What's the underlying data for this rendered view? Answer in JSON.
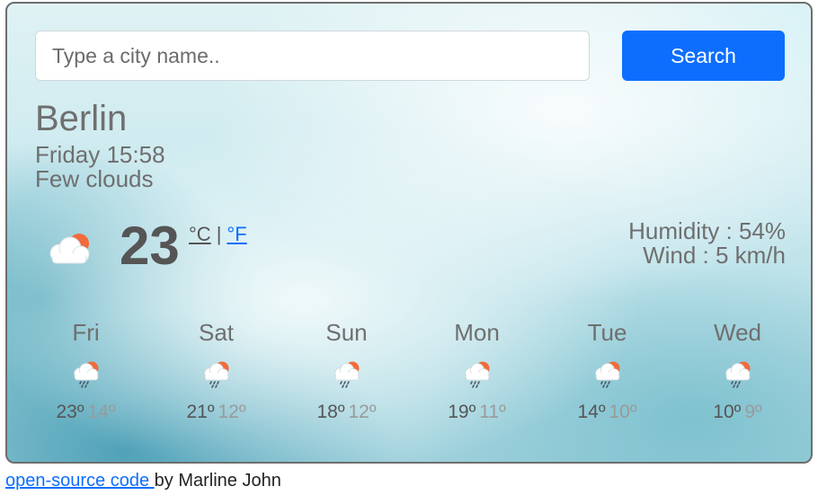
{
  "search": {
    "placeholder": "Type a city name..",
    "value": "",
    "button_label": "Search"
  },
  "current": {
    "city": "Berlin",
    "datetime": "Friday 15:58",
    "description": "Few clouds",
    "temperature": "23",
    "unit_celsius": "°C",
    "unit_separator": "|",
    "unit_fahrenheit": "°F",
    "humidity": "Humidity : 54%",
    "wind": "Wind : 5 km/h",
    "icon": "sun-behind-cloud-icon"
  },
  "forecast": [
    {
      "day": "Fri",
      "max": "23º",
      "min": "14º",
      "icon": "sun-cloud-rain-icon"
    },
    {
      "day": "Sat",
      "max": "21º",
      "min": "12º",
      "icon": "sun-cloud-rain-icon"
    },
    {
      "day": "Sun",
      "max": "18º",
      "min": "12º",
      "icon": "sun-cloud-rain-icon"
    },
    {
      "day": "Mon",
      "max": "19º",
      "min": "11º",
      "icon": "sun-cloud-rain-icon"
    },
    {
      "day": "Tue",
      "max": "14º",
      "min": "10º",
      "icon": "sun-cloud-rain-icon"
    },
    {
      "day": "Wed",
      "max": "10º",
      "min": "9º",
      "icon": "sun-cloud-rain-icon"
    }
  ],
  "footer": {
    "link_text": "open-source code ",
    "byline": " by Marline John"
  },
  "colors": {
    "accent": "#0d6efd",
    "sun": "#f26b3a"
  }
}
